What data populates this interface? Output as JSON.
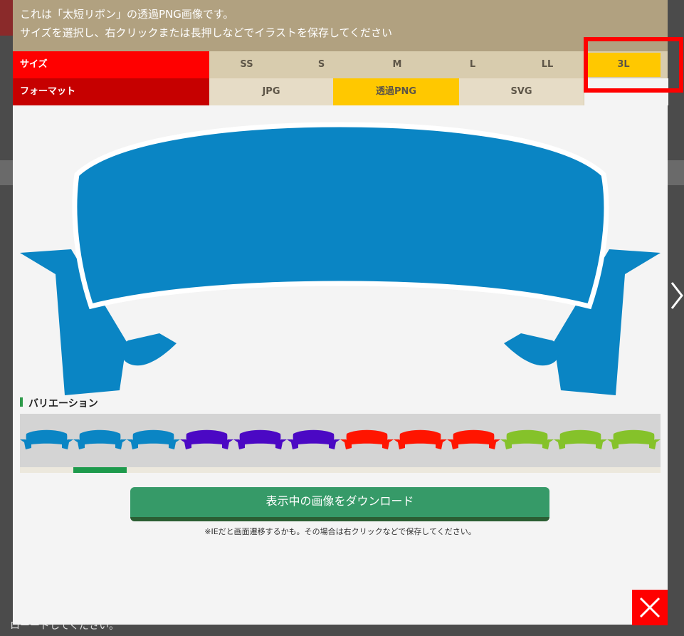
{
  "header": {
    "line1": "これは「太短リボン」の透過PNG画像です。",
    "line2": "サイズを選択し、右クリックまたは長押しなどでイラストを保存してください"
  },
  "size_row": {
    "label": "サイズ",
    "options": [
      "SS",
      "S",
      "M",
      "L",
      "LL",
      "3L"
    ],
    "selected": "3L"
  },
  "format_row": {
    "label": "フォーマット",
    "options": [
      "JPG",
      "透過PNG",
      "SVG"
    ],
    "selected": "透過PNG"
  },
  "variation": {
    "label": "バリエーション",
    "thumbnails": [
      {
        "color": "#0a85c4",
        "icon": "ribbon-icon"
      },
      {
        "color": "#0a85c4",
        "icon": "ribbon-icon"
      },
      {
        "color": "#0a85c4",
        "icon": "ribbon-icon"
      },
      {
        "color": "#4b08c4",
        "icon": "ribbon-icon"
      },
      {
        "color": "#4b08c4",
        "icon": "ribbon-icon"
      },
      {
        "color": "#4b08c4",
        "icon": "ribbon-icon"
      },
      {
        "color": "#ff1500",
        "icon": "ribbon-icon"
      },
      {
        "color": "#ff1500",
        "icon": "ribbon-icon"
      },
      {
        "color": "#ff1500",
        "icon": "ribbon-icon"
      },
      {
        "color": "#85c22a",
        "icon": "ribbon-icon"
      },
      {
        "color": "#85c22a",
        "icon": "ribbon-icon"
      },
      {
        "color": "#85c22a",
        "icon": "ribbon-icon"
      }
    ],
    "active_index": 1
  },
  "main_image": {
    "color": "#0a85c4",
    "icon": "ribbon-icon"
  },
  "download": {
    "label": "表示中の画像をダウンロード",
    "note": "※IEだと画面遷移するかも。その場合は右クリックなどで保存してください。"
  },
  "background": {
    "texts": [
      "ローードしてください。"
    ]
  },
  "colors": {
    "size_label_bg": "#ff0000",
    "format_label_bg": "#c60000",
    "selected_bg": "#ffc800",
    "download_bg": "#369a68",
    "close_bg": "#ff0000"
  },
  "icons": {
    "close": "close-icon",
    "next": "chevron-right-icon"
  }
}
